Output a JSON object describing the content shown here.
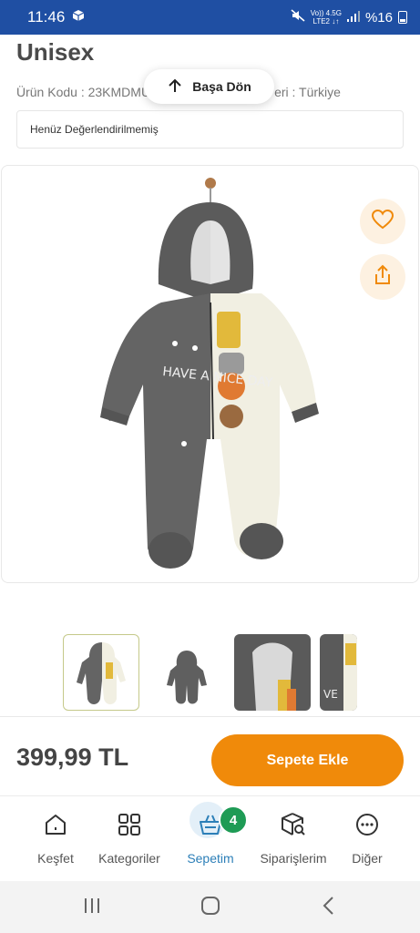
{
  "status_bar": {
    "time": "11:46",
    "network_top": "Vo)) 4.5G",
    "network_bottom": "LTE2 ↓↑",
    "battery": "%16"
  },
  "product": {
    "title": "Unisex",
    "code_label": "Ürün Kodu : 23KMDMU",
    "origin_label": "eri : Türkiye",
    "review_text": "Henüz Değerlendirilmemiş",
    "image_text": "HAVE A NICE DAY"
  },
  "back_to_top": {
    "label": "Başa Dön"
  },
  "price": "399,99 TL",
  "add_to_cart": "Sepete Ekle",
  "thumbnails": [
    {
      "name": "thumb-front"
    },
    {
      "name": "thumb-back"
    },
    {
      "name": "thumb-hood"
    },
    {
      "name": "thumb-detail"
    }
  ],
  "bottom_nav": {
    "cart_count": "4",
    "items": [
      {
        "label": "Keşfet",
        "icon": "home-icon"
      },
      {
        "label": "Kategoriler",
        "icon": "grid-icon"
      },
      {
        "label": "Sepetim",
        "icon": "basket-icon"
      },
      {
        "label": "Siparişlerim",
        "icon": "package-search-icon"
      },
      {
        "label": "Diğer",
        "icon": "more-icon"
      }
    ]
  },
  "colors": {
    "status_bar": "#1f4fa3",
    "accent_orange": "#f08a0a",
    "badge_green": "#1e9b55",
    "active_blue": "#2c7fb8"
  }
}
